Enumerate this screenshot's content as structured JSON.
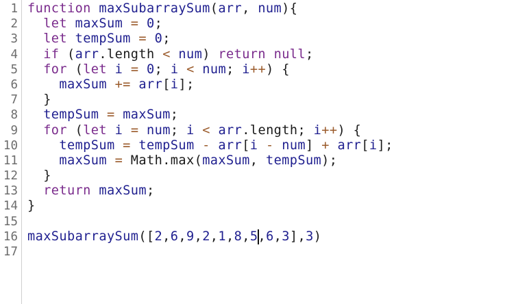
{
  "editor": {
    "cursor": {
      "line": 16,
      "after_token": 14
    },
    "lines": [
      {
        "number": "1",
        "tokens": [
          {
            "t": "function",
            "k": "keyword"
          },
          {
            "t": " ",
            "k": "plain"
          },
          {
            "t": "maxSubarraySum",
            "k": "def"
          },
          {
            "t": "(",
            "k": "punct"
          },
          {
            "t": "arr",
            "k": "def"
          },
          {
            "t": ", ",
            "k": "punct"
          },
          {
            "t": "num",
            "k": "def"
          },
          {
            "t": "){",
            "k": "punct"
          }
        ]
      },
      {
        "number": "2",
        "tokens": [
          {
            "t": "  ",
            "k": "plain"
          },
          {
            "t": "let",
            "k": "keyword"
          },
          {
            "t": " ",
            "k": "plain"
          },
          {
            "t": "maxSum",
            "k": "def"
          },
          {
            "t": " ",
            "k": "plain"
          },
          {
            "t": "=",
            "k": "operator"
          },
          {
            "t": " ",
            "k": "plain"
          },
          {
            "t": "0",
            "k": "number"
          },
          {
            "t": ";",
            "k": "punct"
          }
        ]
      },
      {
        "number": "3",
        "tokens": [
          {
            "t": "  ",
            "k": "plain"
          },
          {
            "t": "let",
            "k": "keyword"
          },
          {
            "t": " ",
            "k": "plain"
          },
          {
            "t": "tempSum",
            "k": "def"
          },
          {
            "t": " ",
            "k": "plain"
          },
          {
            "t": "=",
            "k": "operator"
          },
          {
            "t": " ",
            "k": "plain"
          },
          {
            "t": "0",
            "k": "number"
          },
          {
            "t": ";",
            "k": "punct"
          }
        ]
      },
      {
        "number": "4",
        "tokens": [
          {
            "t": "  ",
            "k": "plain"
          },
          {
            "t": "if",
            "k": "keyword"
          },
          {
            "t": " (",
            "k": "punct"
          },
          {
            "t": "arr",
            "k": "variable"
          },
          {
            "t": ".",
            "k": "punct"
          },
          {
            "t": "length",
            "k": "property"
          },
          {
            "t": " ",
            "k": "plain"
          },
          {
            "t": "<",
            "k": "operator"
          },
          {
            "t": " ",
            "k": "plain"
          },
          {
            "t": "num",
            "k": "variable"
          },
          {
            "t": ") ",
            "k": "punct"
          },
          {
            "t": "return",
            "k": "keyword"
          },
          {
            "t": " ",
            "k": "plain"
          },
          {
            "t": "null",
            "k": "keyword"
          },
          {
            "t": ";",
            "k": "punct"
          }
        ]
      },
      {
        "number": "5",
        "tokens": [
          {
            "t": "  ",
            "k": "plain"
          },
          {
            "t": "for",
            "k": "keyword"
          },
          {
            "t": " (",
            "k": "punct"
          },
          {
            "t": "let",
            "k": "keyword"
          },
          {
            "t": " ",
            "k": "plain"
          },
          {
            "t": "i",
            "k": "def"
          },
          {
            "t": " ",
            "k": "plain"
          },
          {
            "t": "=",
            "k": "operator"
          },
          {
            "t": " ",
            "k": "plain"
          },
          {
            "t": "0",
            "k": "number"
          },
          {
            "t": "; ",
            "k": "punct"
          },
          {
            "t": "i",
            "k": "variable"
          },
          {
            "t": " ",
            "k": "plain"
          },
          {
            "t": "<",
            "k": "operator"
          },
          {
            "t": " ",
            "k": "plain"
          },
          {
            "t": "num",
            "k": "variable"
          },
          {
            "t": "; ",
            "k": "punct"
          },
          {
            "t": "i",
            "k": "variable"
          },
          {
            "t": "++",
            "k": "operator"
          },
          {
            "t": ") {",
            "k": "punct"
          }
        ]
      },
      {
        "number": "6",
        "tokens": [
          {
            "t": "    ",
            "k": "plain"
          },
          {
            "t": "maxSum",
            "k": "variable"
          },
          {
            "t": " ",
            "k": "plain"
          },
          {
            "t": "+=",
            "k": "operator"
          },
          {
            "t": " ",
            "k": "plain"
          },
          {
            "t": "arr",
            "k": "variable"
          },
          {
            "t": "[",
            "k": "punct"
          },
          {
            "t": "i",
            "k": "variable"
          },
          {
            "t": "];",
            "k": "punct"
          }
        ]
      },
      {
        "number": "7",
        "tokens": [
          {
            "t": "  }",
            "k": "punct"
          }
        ]
      },
      {
        "number": "8",
        "tokens": [
          {
            "t": "  ",
            "k": "plain"
          },
          {
            "t": "tempSum",
            "k": "variable"
          },
          {
            "t": " ",
            "k": "plain"
          },
          {
            "t": "=",
            "k": "operator"
          },
          {
            "t": " ",
            "k": "plain"
          },
          {
            "t": "maxSum",
            "k": "variable"
          },
          {
            "t": ";",
            "k": "punct"
          }
        ]
      },
      {
        "number": "9",
        "tokens": [
          {
            "t": "  ",
            "k": "plain"
          },
          {
            "t": "for",
            "k": "keyword"
          },
          {
            "t": " (",
            "k": "punct"
          },
          {
            "t": "let",
            "k": "keyword"
          },
          {
            "t": " ",
            "k": "plain"
          },
          {
            "t": "i",
            "k": "def"
          },
          {
            "t": " ",
            "k": "plain"
          },
          {
            "t": "=",
            "k": "operator"
          },
          {
            "t": " ",
            "k": "plain"
          },
          {
            "t": "num",
            "k": "variable"
          },
          {
            "t": "; ",
            "k": "punct"
          },
          {
            "t": "i",
            "k": "variable"
          },
          {
            "t": " ",
            "k": "plain"
          },
          {
            "t": "<",
            "k": "operator"
          },
          {
            "t": " ",
            "k": "plain"
          },
          {
            "t": "arr",
            "k": "variable"
          },
          {
            "t": ".",
            "k": "punct"
          },
          {
            "t": "length",
            "k": "property"
          },
          {
            "t": "; ",
            "k": "punct"
          },
          {
            "t": "i",
            "k": "variable"
          },
          {
            "t": "++",
            "k": "operator"
          },
          {
            "t": ") {",
            "k": "punct"
          }
        ]
      },
      {
        "number": "10",
        "tokens": [
          {
            "t": "    ",
            "k": "plain"
          },
          {
            "t": "tempSum",
            "k": "variable"
          },
          {
            "t": " ",
            "k": "plain"
          },
          {
            "t": "=",
            "k": "operator"
          },
          {
            "t": " ",
            "k": "plain"
          },
          {
            "t": "tempSum",
            "k": "variable"
          },
          {
            "t": " ",
            "k": "plain"
          },
          {
            "t": "-",
            "k": "operator"
          },
          {
            "t": " ",
            "k": "plain"
          },
          {
            "t": "arr",
            "k": "variable"
          },
          {
            "t": "[",
            "k": "punct"
          },
          {
            "t": "i",
            "k": "variable"
          },
          {
            "t": " ",
            "k": "plain"
          },
          {
            "t": "-",
            "k": "operator"
          },
          {
            "t": " ",
            "k": "plain"
          },
          {
            "t": "num",
            "k": "variable"
          },
          {
            "t": "]",
            "k": "punct"
          },
          {
            "t": " ",
            "k": "plain"
          },
          {
            "t": "+",
            "k": "operator"
          },
          {
            "t": " ",
            "k": "plain"
          },
          {
            "t": "arr",
            "k": "variable"
          },
          {
            "t": "[",
            "k": "punct"
          },
          {
            "t": "i",
            "k": "variable"
          },
          {
            "t": "];",
            "k": "punct"
          }
        ]
      },
      {
        "number": "11",
        "tokens": [
          {
            "t": "    ",
            "k": "plain"
          },
          {
            "t": "maxSum",
            "k": "variable"
          },
          {
            "t": " ",
            "k": "plain"
          },
          {
            "t": "=",
            "k": "operator"
          },
          {
            "t": " ",
            "k": "plain"
          },
          {
            "t": "Math",
            "k": "plain"
          },
          {
            "t": ".",
            "k": "punct"
          },
          {
            "t": "max",
            "k": "property"
          },
          {
            "t": "(",
            "k": "punct"
          },
          {
            "t": "maxSum",
            "k": "variable"
          },
          {
            "t": ", ",
            "k": "punct"
          },
          {
            "t": "tempSum",
            "k": "variable"
          },
          {
            "t": ");",
            "k": "punct"
          }
        ]
      },
      {
        "number": "12",
        "tokens": [
          {
            "t": "  }",
            "k": "punct"
          }
        ]
      },
      {
        "number": "13",
        "tokens": [
          {
            "t": "  ",
            "k": "plain"
          },
          {
            "t": "return",
            "k": "keyword"
          },
          {
            "t": " ",
            "k": "plain"
          },
          {
            "t": "maxSum",
            "k": "variable"
          },
          {
            "t": ";",
            "k": "punct"
          }
        ]
      },
      {
        "number": "14",
        "tokens": [
          {
            "t": "}",
            "k": "punct"
          }
        ]
      },
      {
        "number": "15",
        "tokens": []
      },
      {
        "number": "16",
        "tokens": [
          {
            "t": "maxSubarraySum",
            "k": "variable"
          },
          {
            "t": "([",
            "k": "punct"
          },
          {
            "t": "2",
            "k": "number"
          },
          {
            "t": ",",
            "k": "punct"
          },
          {
            "t": "6",
            "k": "number"
          },
          {
            "t": ",",
            "k": "punct"
          },
          {
            "t": "9",
            "k": "number"
          },
          {
            "t": ",",
            "k": "punct"
          },
          {
            "t": "2",
            "k": "number"
          },
          {
            "t": ",",
            "k": "punct"
          },
          {
            "t": "1",
            "k": "number"
          },
          {
            "t": ",",
            "k": "punct"
          },
          {
            "t": "8",
            "k": "number"
          },
          {
            "t": ",",
            "k": "punct"
          },
          {
            "t": "5",
            "k": "number"
          },
          {
            "t": ",",
            "k": "punct"
          },
          {
            "t": "6",
            "k": "number"
          },
          {
            "t": ",",
            "k": "punct"
          },
          {
            "t": "3",
            "k": "number"
          },
          {
            "t": "],",
            "k": "punct"
          },
          {
            "t": "3",
            "k": "number"
          },
          {
            "t": ")",
            "k": "punct"
          }
        ]
      },
      {
        "number": "17",
        "tokens": []
      }
    ]
  }
}
